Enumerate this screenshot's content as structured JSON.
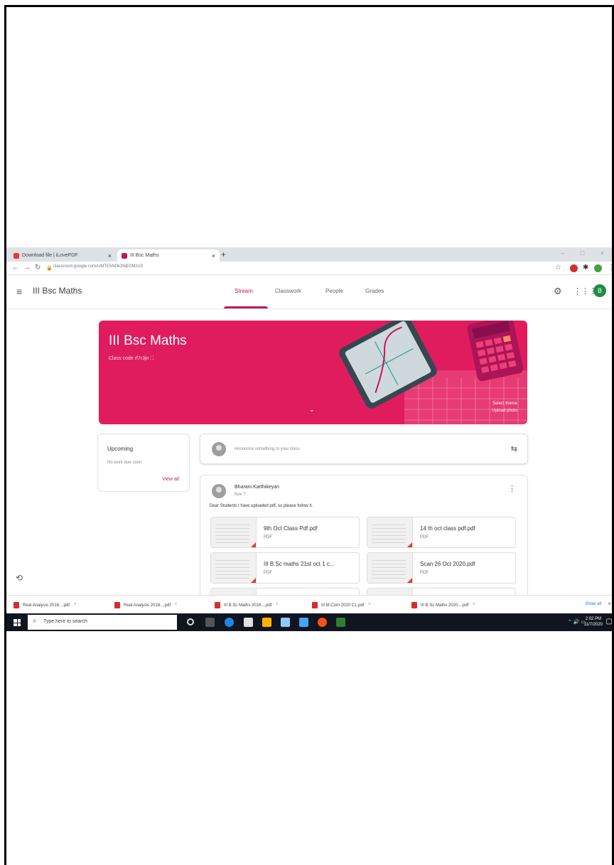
{
  "browser": {
    "tabs": [
      {
        "label": "Download file | iLovePDF",
        "close": "×"
      },
      {
        "label": "III Bsc Maths",
        "close": "×"
      }
    ],
    "new_tab": "+",
    "url": "classroom.google.com/c/MTE5NDk3NjE0MzU0",
    "window_controls": "– □ ×"
  },
  "classroom": {
    "menu_icon": "≡",
    "class_name": "III Bsc Maths",
    "nav": [
      "Stream",
      "Classwork",
      "People",
      "Grades"
    ],
    "active_nav": "Stream",
    "avatar_letter": "B",
    "accent": "#e01c5f"
  },
  "banner": {
    "title": "III Bsc Maths",
    "class_code": "Class code  rf7r3jn  ⛶",
    "select_theme": "Select theme",
    "upload_photo": "Upload photo",
    "chevron": "⌄"
  },
  "upcoming": {
    "title": "Upcoming",
    "subtitle": "No work due soon",
    "view_all": "View all"
  },
  "announce": {
    "placeholder": "Announce something to your class"
  },
  "post": {
    "author": "Bharani Karthikeyan",
    "date": "Nov 7",
    "text": "Dear Students I have uploaded pdf, so please follow it.",
    "attachments": [
      {
        "name": "9th Oct Class Pdf.pdf",
        "type": "PDF"
      },
      {
        "name": "14 th oct class pdf.pdf",
        "type": "PDF"
      },
      {
        "name": "III B.Sc maths 21st oct 1 c...",
        "type": "PDF"
      },
      {
        "name": "Scan 26 Oct 2020.pdf",
        "type": "PDF"
      }
    ]
  },
  "downloads": {
    "items": [
      "Real Analysis 2016....pdf",
      "Real Analysis 2018....pdf",
      "III B.Sc Maths 2016....pdf",
      "III M.Com 2020 C1.pdf",
      "III B.Sc Maths 2020....pdf"
    ],
    "show_all": "Show all",
    "close": "×"
  },
  "taskbar": {
    "search_placeholder": "Type here to search",
    "time": "2:02 PM",
    "date": "11/7/2020"
  }
}
